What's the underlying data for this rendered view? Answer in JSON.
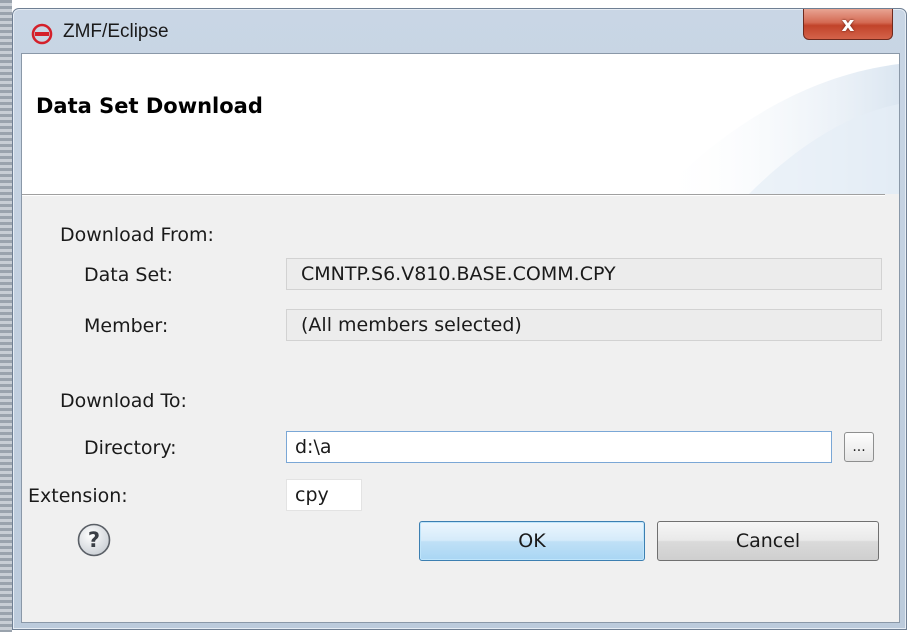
{
  "window": {
    "title": "ZMF/Eclipse",
    "close_label": "x"
  },
  "banner": {
    "title": "Data Set Download"
  },
  "download_from": {
    "heading": "Download From:",
    "data_set_label": "Data Set:",
    "data_set_value": "CMNTP.S6.V810.BASE.COMM.CPY",
    "member_label": "Member:",
    "member_value": "(All members selected)"
  },
  "download_to": {
    "heading": "Download To:",
    "directory_label": "Directory:",
    "directory_value": "d:\\a",
    "browse_label": "...",
    "extension_label": "Extension:",
    "extension_value": "cpy"
  },
  "buttons": {
    "help_glyph": "?",
    "ok_label": "OK",
    "cancel_label": "Cancel"
  },
  "colors": {
    "accent_blue": "#3c7fb1",
    "close_red": "#c1432a",
    "app_icon_red": "#d4202a"
  },
  "icons": {
    "app": "zmf-app-icon",
    "close": "close-icon",
    "help": "help-icon"
  }
}
